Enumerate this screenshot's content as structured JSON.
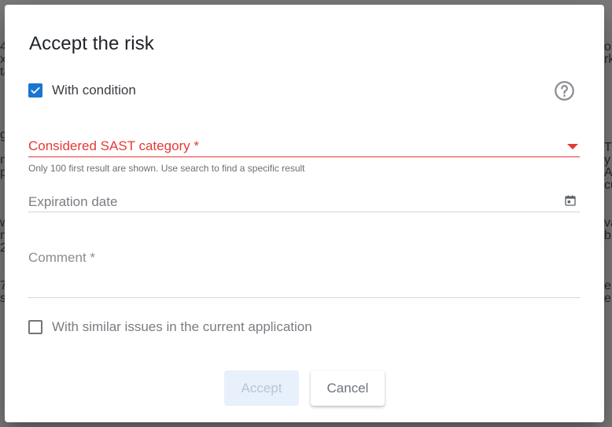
{
  "background": {
    "left_fragments": [
      "4",
      "x",
      "ta",
      "",
      "",
      "",
      "",
      "g",
      "",
      "ng",
      "p",
      "",
      "",
      "",
      "w",
      "n",
      "2",
      "",
      "",
      "7",
      "s"
    ],
    "right_fragments": [
      "oi",
      "rk",
      "",
      "",
      "",
      "",
      "",
      "",
      "T",
      "y",
      "Ar",
      "cu",
      "",
      "",
      "va",
      "b",
      "",
      "",
      "",
      "e",
      "e"
    ]
  },
  "dialog": {
    "title": "Accept the risk",
    "with_condition": {
      "label": "With condition",
      "checked": true
    },
    "help_icon": "help-circle-icon",
    "category": {
      "label": "Considered SAST category *",
      "hint": "Only 100 first result are shown. Use search to find a specific result"
    },
    "expiration": {
      "placeholder": "Expiration date",
      "icon": "calendar-icon"
    },
    "comment": {
      "placeholder": "Comment *"
    },
    "similar": {
      "label": "With similar issues in the current application",
      "checked": false
    },
    "buttons": {
      "accept": "Accept",
      "cancel": "Cancel"
    },
    "colors": {
      "accent": "#1976d2",
      "error": "#e53935",
      "disabled_bg": "#e8f0fc"
    }
  }
}
